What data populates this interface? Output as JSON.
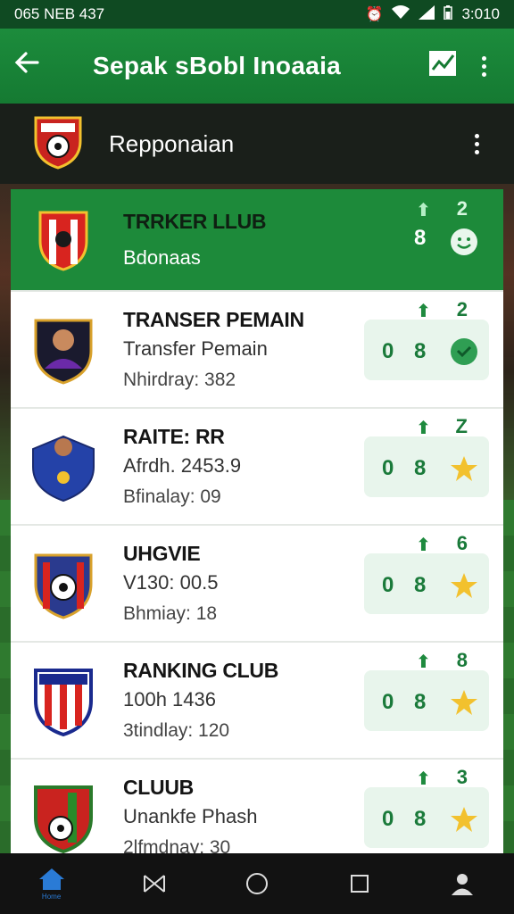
{
  "status_bar": {
    "left_text": "065 NEB 437",
    "time": "3:010"
  },
  "app_bar": {
    "title": "Sepak sBobl Inoaaia"
  },
  "section": {
    "title": "Repponaian"
  },
  "rows": [
    {
      "title": "TRRKER LLUB",
      "line2": "Bdonaas",
      "line3": "",
      "top_num": "2",
      "zero": "",
      "eight": "8",
      "badge": "smile-badge",
      "highlight": true
    },
    {
      "title": "TRANSER PEMAIN",
      "line2": "Transfer Pemain",
      "line3": "Nhirdray:  382",
      "top_num": "2",
      "zero": "0",
      "eight": "8",
      "badge": "green-check-badge",
      "highlight": false
    },
    {
      "title": "RAITE: RR",
      "line2": "Afrdh. 2453.9",
      "line3": "Bfinalay:  09",
      "top_num": "Z",
      "zero": "0",
      "eight": "8",
      "badge": "star-badge",
      "highlight": false
    },
    {
      "title": "UHGVIE",
      "line2": "V130: 00.5",
      "line3": "Bhmiay:  18",
      "top_num": "6",
      "zero": "0",
      "eight": "8",
      "badge": "star-badge",
      "highlight": false
    },
    {
      "title": "RANKING CLUB",
      "line2": "100h 1436",
      "line3": "3tindlay:  120",
      "top_num": "8",
      "zero": "0",
      "eight": "8",
      "badge": "star-badge",
      "highlight": false
    },
    {
      "title": "CLUUB",
      "line2": "Unankfe Phash",
      "line3": "2lfmdnay:  30",
      "top_num": "3",
      "zero": "0",
      "eight": "8",
      "badge": "star-badge",
      "highlight": false
    }
  ],
  "nav": {
    "home_sub": "Home"
  },
  "colors": {
    "brand_green": "#1c8c3c",
    "star_yellow": "#f2c12e",
    "stat_bg": "#e8f5ec"
  }
}
